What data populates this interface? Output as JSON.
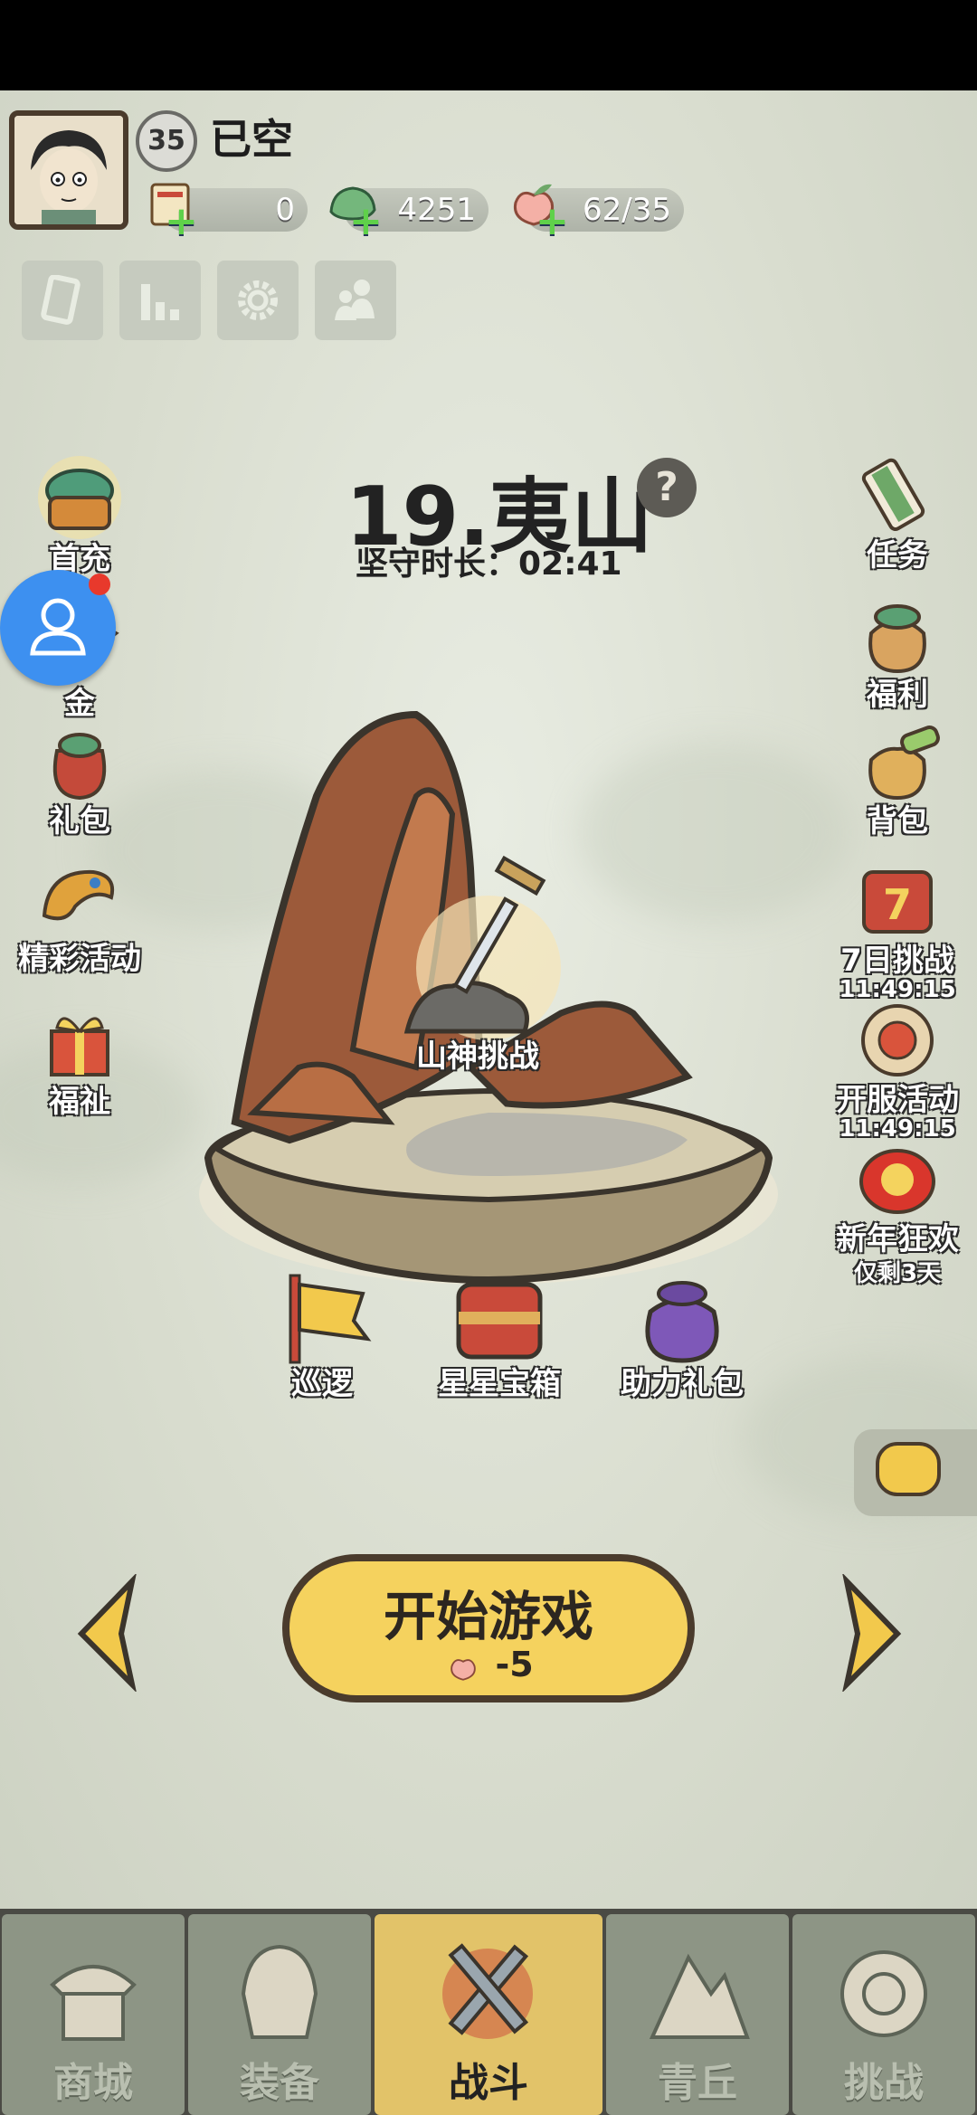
{
  "player": {
    "level": "35",
    "name": "已空"
  },
  "resources": [
    {
      "name": "scroll",
      "value": "0"
    },
    {
      "name": "jade",
      "value": "4251"
    },
    {
      "name": "peach",
      "value": "62/35"
    }
  ],
  "stage": {
    "title": "19.夷山",
    "guard_time": "坚守时长：02:41",
    "challenge_label": "山神挑战"
  },
  "left_menu": [
    "首充",
    "金",
    "礼包",
    "精彩活动",
    "福祉"
  ],
  "right_menu": [
    {
      "label": "任务"
    },
    {
      "label": "福利"
    },
    {
      "label": "背包"
    },
    {
      "label": "7日挑战",
      "timer": "11:49:15"
    },
    {
      "label": "开服活动",
      "timer": "11:49:15"
    },
    {
      "label": "新年狂欢",
      "timer": "仅剩3天"
    }
  ],
  "bottom_actions": [
    "巡逻",
    "星星宝箱",
    "助力礼包"
  ],
  "start_button": {
    "label": "开始游戏",
    "cost": "-5"
  },
  "nav": [
    "商城",
    "装备",
    "战斗",
    "青丘",
    "挑战"
  ],
  "colors": {
    "accent": "#f5d25e",
    "nav_active": "#e2c369",
    "nav_bg": "#8d9585"
  }
}
